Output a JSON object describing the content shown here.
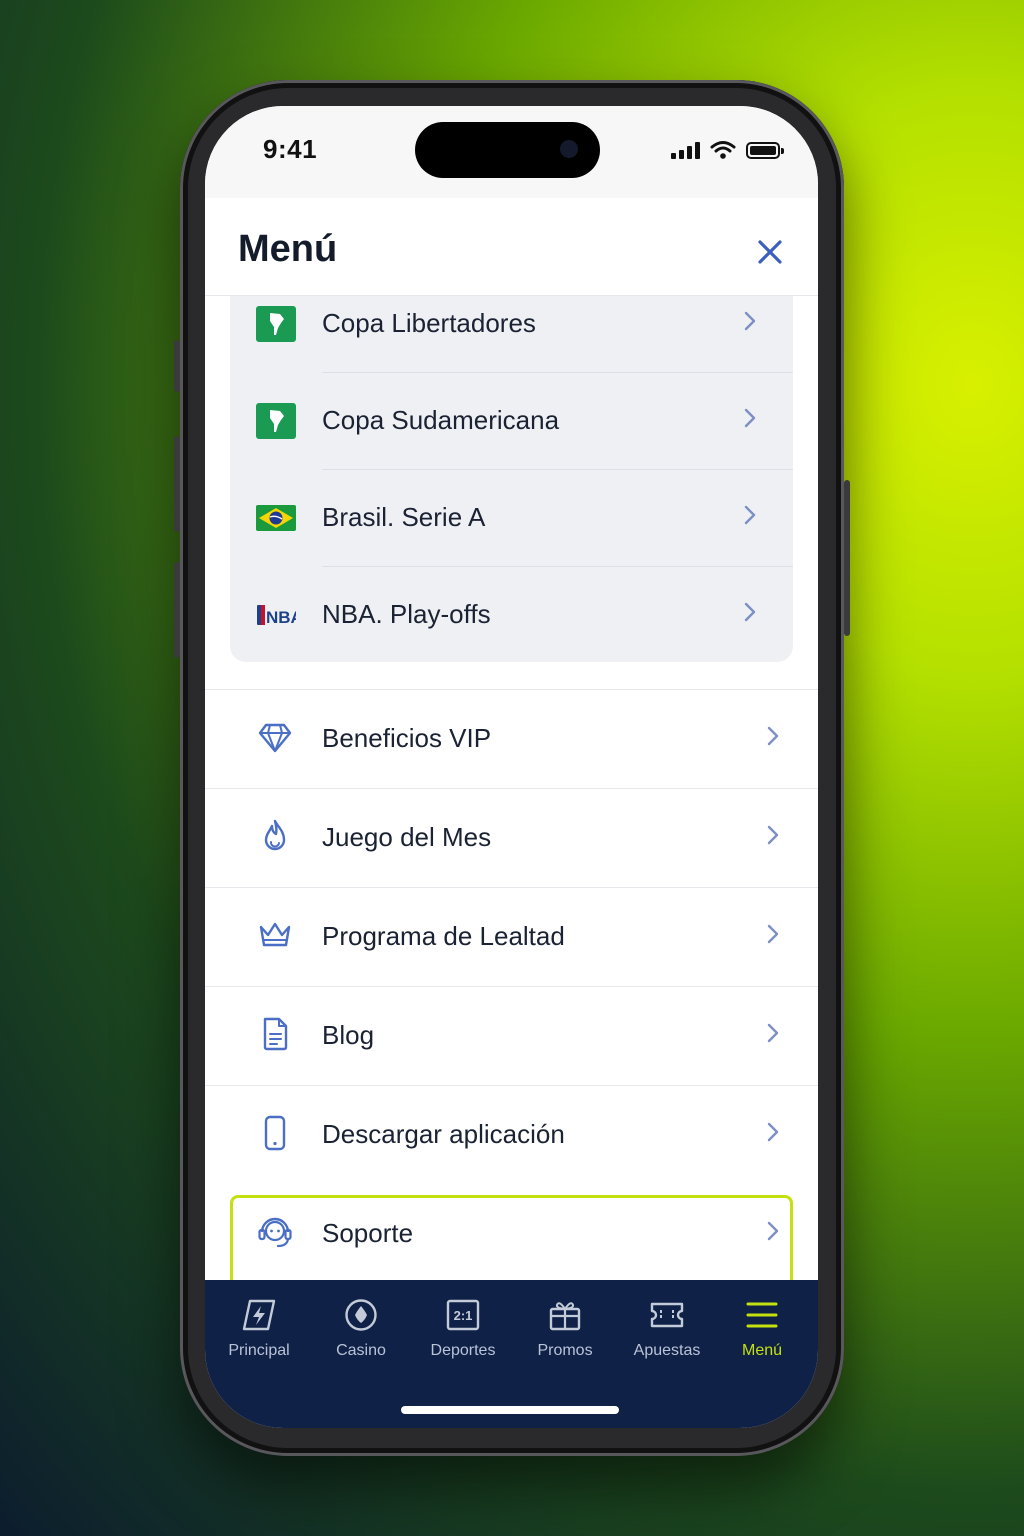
{
  "status_bar": {
    "time": "9:41"
  },
  "header": {
    "title": "Menú"
  },
  "competitions": [
    {
      "label": "Copa Libertadores",
      "icon": "south-america-map-icon"
    },
    {
      "label": "Copa Sudamericana",
      "icon": "south-america-map-icon"
    },
    {
      "label": "Brasil. Serie A",
      "icon": "brazil-flag-icon"
    },
    {
      "label": "NBA. Play-offs",
      "icon": "nba-logo-icon"
    }
  ],
  "menu_items": [
    {
      "label": "Beneficios VIP",
      "icon": "diamond-icon"
    },
    {
      "label": "Juego del Mes",
      "icon": "flame-icon"
    },
    {
      "label": "Programa de Lealtad",
      "icon": "crown-icon"
    },
    {
      "label": "Blog",
      "icon": "document-icon"
    },
    {
      "label": "Descargar aplicación",
      "icon": "smartphone-icon",
      "highlighted": true
    },
    {
      "label": "Soporte",
      "icon": "headset-icon"
    }
  ],
  "tab_bar": [
    {
      "label": "Principal",
      "icon": "lightning-icon"
    },
    {
      "label": "Casino",
      "icon": "casino-chip-icon"
    },
    {
      "label": "Deportes",
      "icon": "odds-icon",
      "icon_text": "2:1"
    },
    {
      "label": "Promos",
      "icon": "gift-icon"
    },
    {
      "label": "Apuestas",
      "icon": "ticket-icon"
    },
    {
      "label": "Menú",
      "icon": "hamburger-icon",
      "active": true
    }
  ],
  "colors": {
    "accent": "#c4e10f",
    "icon_blue": "#4a6fc4",
    "tab_bar_bg": "#0f2147",
    "card_bg": "#eef0f4"
  }
}
